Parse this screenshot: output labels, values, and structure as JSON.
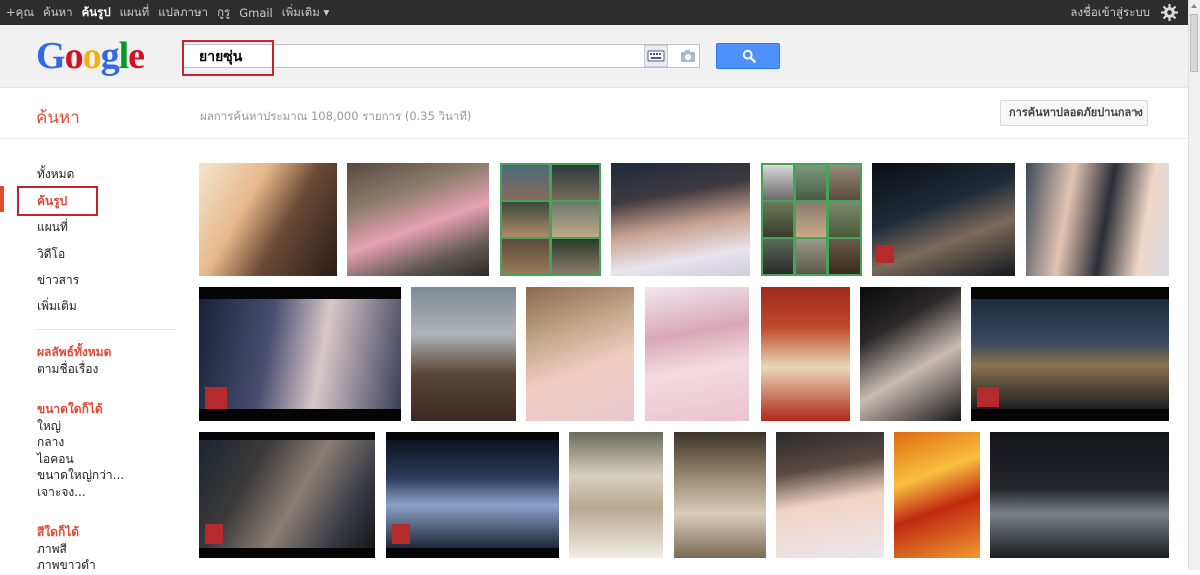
{
  "topbar": {
    "links": [
      "+คุณ",
      "ค้นหา",
      "ค้นรูป",
      "แผนที่",
      "แปลภาษา",
      "กูรู",
      "Gmail",
      "เพิ่มเติม ▾"
    ],
    "active_index": 2,
    "signin": "ลงชื่อเข้าสู่ระบบ"
  },
  "logo": {
    "letters": [
      "G",
      "o",
      "o",
      "g",
      "l",
      "e"
    ],
    "colors": [
      "#3369e8",
      "#d50f25",
      "#eeb211",
      "#3369e8",
      "#009925",
      "#d50f25"
    ]
  },
  "search": {
    "value": "ยายซุ่น"
  },
  "results": {
    "title": "ค้นหา",
    "stats": "ผลการค้นหาประมาณ 108,000 รายการ (0.35 วินาที)",
    "safe_search": "การค้นหาปลอดภัยปานกลาง"
  },
  "sidebar": {
    "items": [
      "ทั้งหมด",
      "ค้นรูป",
      "แผนที่",
      "วิดีโอ",
      "ข่าวสาร",
      "เพิ่มเติม"
    ],
    "active_index": 1,
    "section_results": {
      "title": "ผลลัพธ์ทั้งหมด",
      "items": [
        "ตามชื่อเรื่อง"
      ]
    },
    "section_size": {
      "title": "ขนาดใดก็ได้",
      "items": [
        "ใหญ่",
        "กลาง",
        "ไอคอน",
        "ขนาดใหญ่กว่า...",
        "เจาะจง..."
      ]
    },
    "section_color": {
      "title": "สีใดก็ได้",
      "items": [
        "ภาพสี",
        "ภาพขาวดำ"
      ]
    }
  },
  "colors": {
    "accent": "#dd4b39",
    "search_button": "#4d90fe",
    "topbar": "#2d2d2d"
  }
}
